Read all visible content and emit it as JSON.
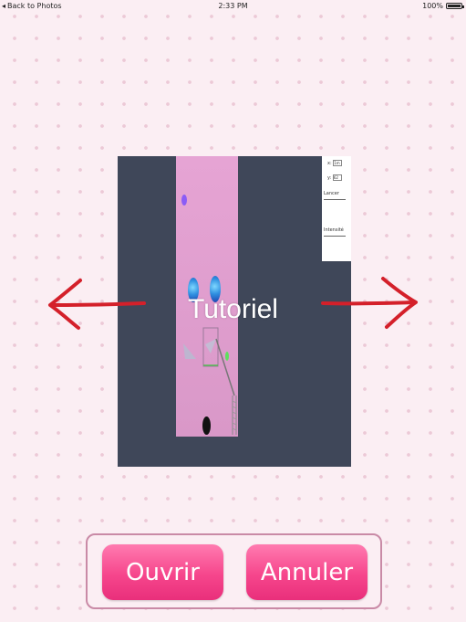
{
  "status_bar": {
    "back_label": "Back to Photos",
    "time": "2:33 PM",
    "battery": "100%",
    "battery_level": 1.0
  },
  "preview": {
    "caption": "Tutoriel",
    "settings_panel": {
      "row1_label": "x:",
      "row1_value": "1m",
      "row2_label": "y:",
      "row2_value": "62",
      "label3": "Lancer",
      "label4": "Intensité"
    }
  },
  "navigation": {
    "prev_icon": "left-arrow-icon",
    "next_icon": "right-arrow-icon",
    "arrow_color": "#d4202a"
  },
  "dialog": {
    "open_label": "Ouvrir",
    "cancel_label": "Annuler",
    "accent": "#f6468c"
  }
}
